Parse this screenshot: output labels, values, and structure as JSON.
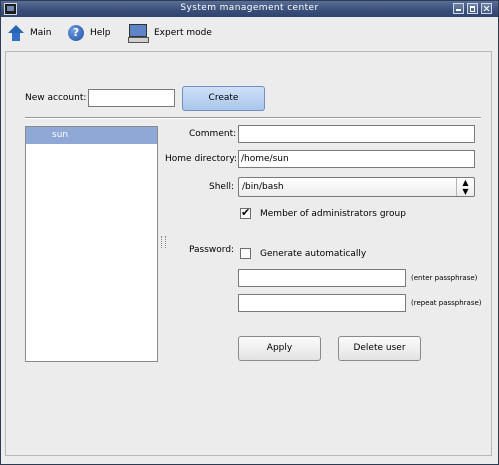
{
  "window": {
    "title": "System management center"
  },
  "toolbar": {
    "main_label": "Main",
    "help_label": "Help",
    "expert_label": "Expert mode"
  },
  "new_account": {
    "label": "New account:",
    "value": "",
    "create_label": "Create"
  },
  "users": {
    "items": [
      {
        "label": "sun",
        "selected": true
      }
    ]
  },
  "form": {
    "comment_label": "Comment:",
    "comment_value": "",
    "home_label": "Home directory:",
    "home_value": "/home/sun",
    "shell_label": "Shell:",
    "shell_value": "/bin/bash",
    "admin_label": "Member of administrators group",
    "admin_checked": true,
    "password_label": "Password:",
    "generate_label": "Generate automatically",
    "generate_checked": false,
    "pass1_value": "",
    "pass1_hint": "(enter passphrase)",
    "pass2_value": "",
    "pass2_hint": "(repeat passphrase)",
    "apply_label": "Apply",
    "delete_label": "Delete user"
  }
}
